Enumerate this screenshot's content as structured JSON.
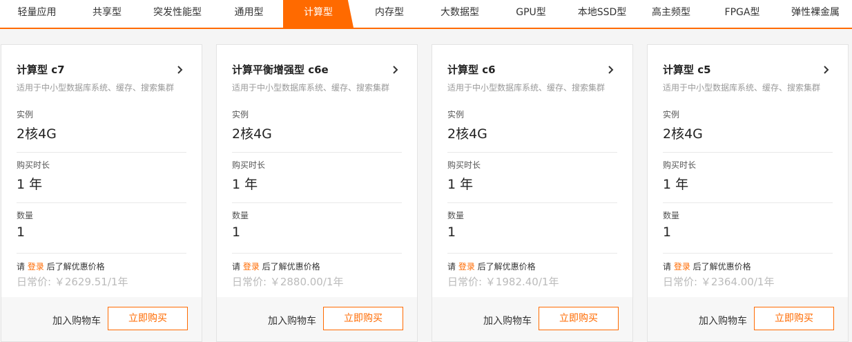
{
  "tabs": [
    {
      "label": "轻量应用"
    },
    {
      "label": "共享型"
    },
    {
      "label": "突发性能型"
    },
    {
      "label": "通用型"
    },
    {
      "label": "计算型",
      "active": true
    },
    {
      "label": "内存型"
    },
    {
      "label": "大数据型"
    },
    {
      "label": "GPU型"
    },
    {
      "label": "本地SSD型"
    },
    {
      "label": "高主频型"
    },
    {
      "label": "FPGA型"
    },
    {
      "label": "弹性裸金属"
    }
  ],
  "accent_color": "#ff6a00",
  "cards": [
    {
      "title": "计算型 c7",
      "desc": "适用于中小型数据库系统、缓存、搜索集群",
      "instance_label": "实例",
      "instance_value": "2核4G",
      "duration_label": "购买时长",
      "duration_value": "1 年",
      "qty_label": "数量",
      "qty_value": "1",
      "login_prefix": "请 ",
      "login_link": "登录",
      "login_suffix": " 后了解优惠价格",
      "price": "日常价: ￥2629.51/1年",
      "cart_label": "加入购物车",
      "buy_label": "立即购买"
    },
    {
      "title": "计算平衡增强型 c6e",
      "desc": "适用于中小型数据库系统、缓存、搜索集群",
      "instance_label": "实例",
      "instance_value": "2核4G",
      "duration_label": "购买时长",
      "duration_value": "1 年",
      "qty_label": "数量",
      "qty_value": "1",
      "login_prefix": "请 ",
      "login_link": "登录",
      "login_suffix": " 后了解优惠价格",
      "price": "日常价: ￥2880.00/1年",
      "cart_label": "加入购物车",
      "buy_label": "立即购买"
    },
    {
      "title": "计算型 c6",
      "desc": "适用于中小型数据库系统、缓存、搜索集群",
      "instance_label": "实例",
      "instance_value": "2核4G",
      "duration_label": "购买时长",
      "duration_value": "1 年",
      "qty_label": "数量",
      "qty_value": "1",
      "login_prefix": "请 ",
      "login_link": "登录",
      "login_suffix": " 后了解优惠价格",
      "price": "日常价: ￥1982.40/1年",
      "cart_label": "加入购物车",
      "buy_label": "立即购买"
    },
    {
      "title": "计算型 c5",
      "desc": "适用于中小型数据库系统、缓存、搜索集群",
      "instance_label": "实例",
      "instance_value": "2核4G",
      "duration_label": "购买时长",
      "duration_value": "1 年",
      "qty_label": "数量",
      "qty_value": "1",
      "login_prefix": "请 ",
      "login_link": "登录",
      "login_suffix": " 后了解优惠价格",
      "price": "日常价: ￥2364.00/1年",
      "cart_label": "加入购物车",
      "buy_label": "立即购买"
    }
  ]
}
